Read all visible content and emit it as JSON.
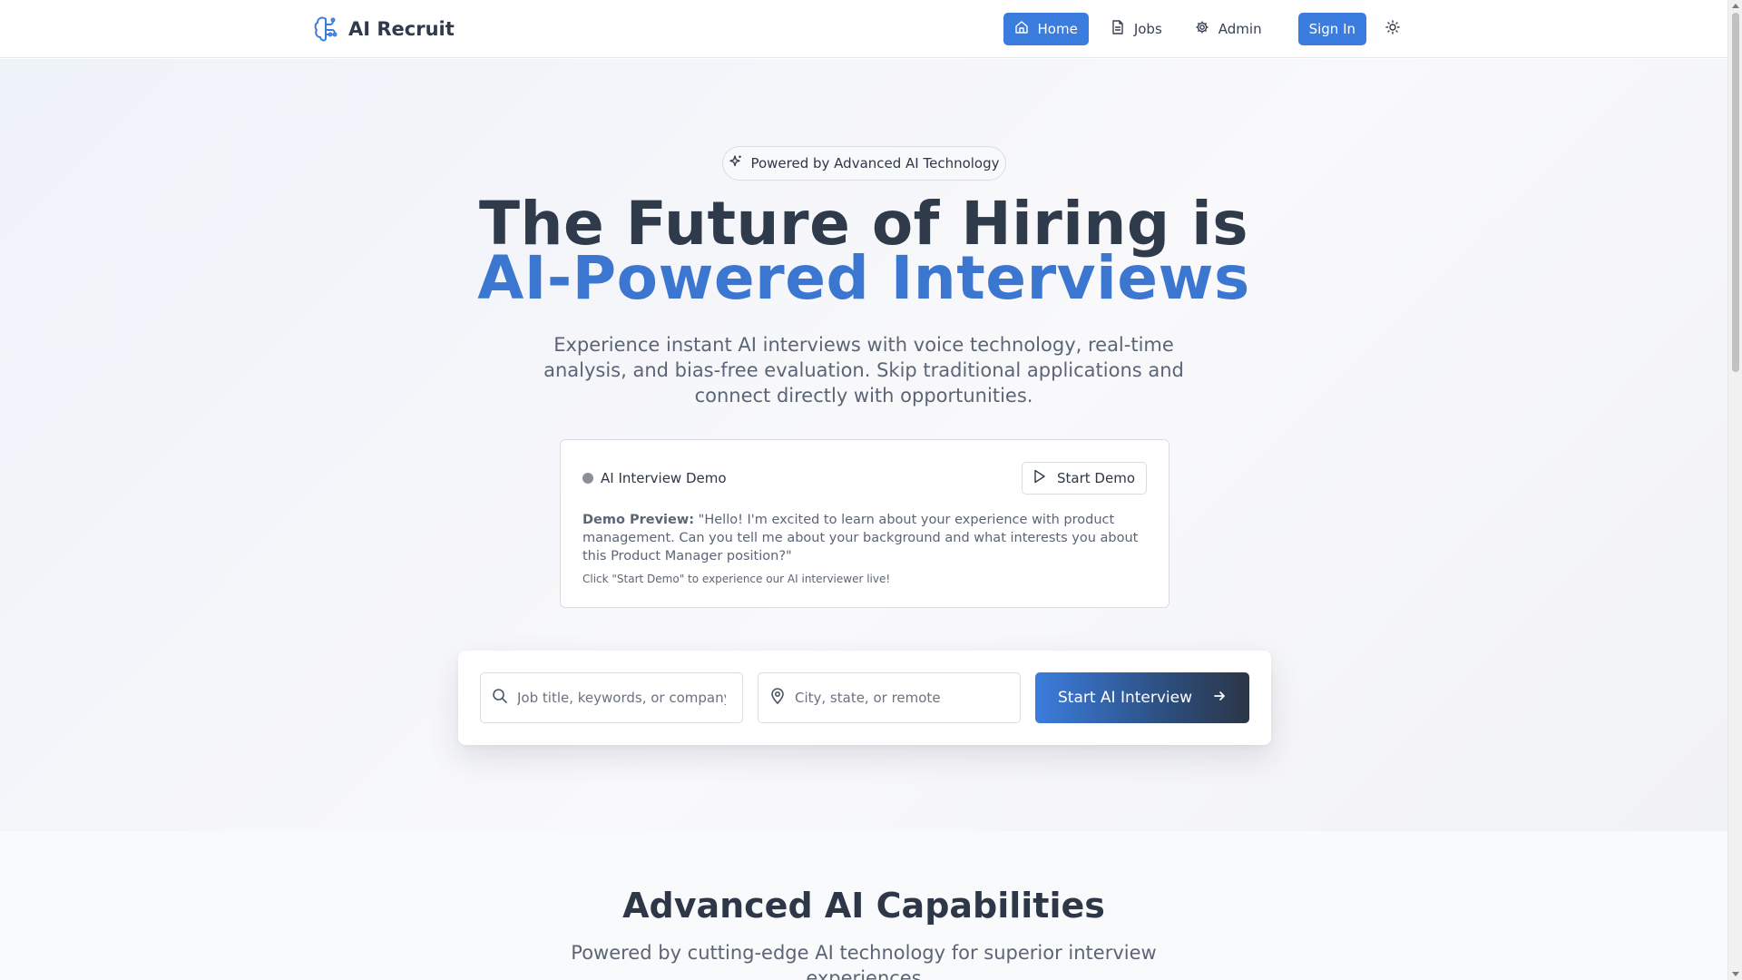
{
  "header": {
    "brand": "AI Recruit",
    "nav": [
      {
        "label": "Home",
        "icon": "home-icon",
        "active": true
      },
      {
        "label": "Jobs",
        "icon": "file-icon",
        "active": false
      },
      {
        "label": "Admin",
        "icon": "gear-icon",
        "active": false
      }
    ],
    "signin_label": "Sign In",
    "theme_icon": "sun-icon"
  },
  "hero": {
    "badge": "Powered by Advanced AI Technology",
    "title_line1": "The Future of Hiring is",
    "title_line2": "AI-Powered Interviews",
    "subtitle": "Experience instant AI interviews with voice technology, real-time analysis, and bias-free evaluation. Skip traditional applications and connect directly with opportunities."
  },
  "demo": {
    "title": "AI Interview Demo",
    "button_label": "Start Demo",
    "preview_label": "Demo Preview:",
    "preview_text": " \"Hello! I'm excited to learn about your experience with product management. Can you tell me about your background and what interests you about this Product Manager position?\"",
    "hint": "Click \"Start Demo\" to experience our AI interviewer live!"
  },
  "search": {
    "keyword_placeholder": "Job title, keywords, or company",
    "location_placeholder": "City, state, or remote",
    "cta_label": "Start AI Interview"
  },
  "features": {
    "title": "Advanced AI Capabilities",
    "subtitle": "Powered by cutting-edge AI technology for superior interview experiences"
  },
  "colors": {
    "accent": "#3b7dde",
    "title_dark": "#2f3a4b",
    "title_accent": "#3b77d1"
  }
}
